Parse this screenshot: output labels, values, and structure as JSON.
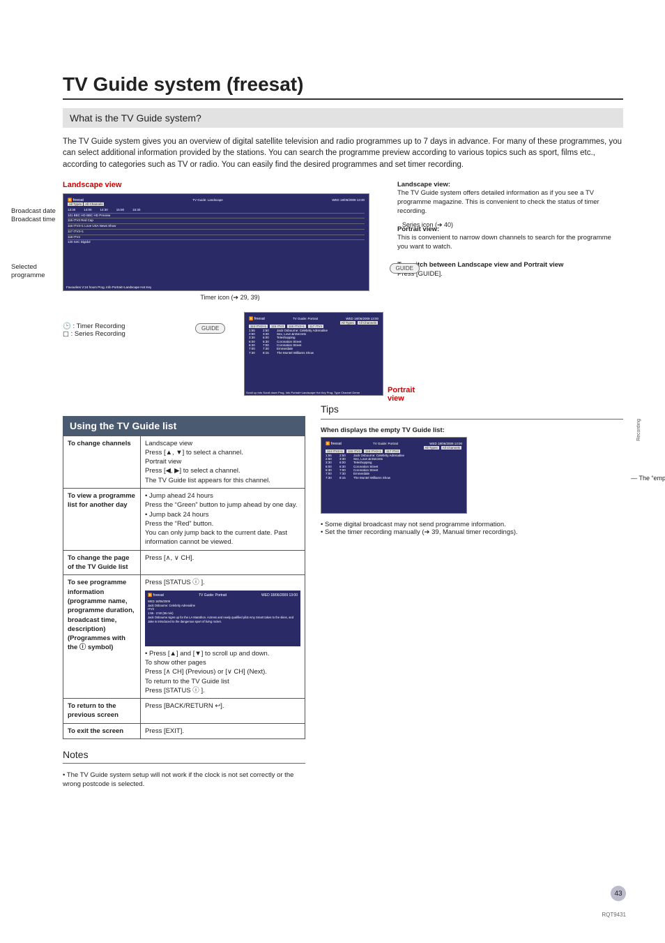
{
  "title": "TV Guide system (freesat)",
  "section1": {
    "heading": "What is the TV Guide system?",
    "body": "The TV Guide system gives you an overview of digital satellite television and radio programmes up to 7 days in advance. For many of these programmes, you can select additional information provided by the stations. You can search the programme preview according to various topics such as sport, films etc., according to categories such as TV or radio. You can easily find the desired programmes and set timer recording."
  },
  "landscape": {
    "label": "Landscape view",
    "broadcast_date": "Broadcast date",
    "broadcast_time": "Broadcast time",
    "selected_programme": "Selected programme",
    "timer_icon": "Timer icon (➔ 29, 39)",
    "series_icon": "Series icon (➔ 40)",
    "timer_rec_legend": ": Timer Recording",
    "series_rec_legend": ": Series Recording",
    "guide_btn": "GUIDE"
  },
  "fig_l": {
    "title": "TV Guide: Landscape",
    "date": "WED 18/06/2009 13:30",
    "tabs": [
      "All Types",
      "All Channels"
    ],
    "cols": [
      "13:30",
      "14:00",
      "14:30",
      "15:00",
      "15:30"
    ],
    "rows": [
      "101 BBC HD  BBC HD Preview",
      "115 ITV3  Red Cap",
      "116 ITV3+1  Love USA   News Show",
      "117 ITV3+1",
      "118 ITV4",
      "120 S4C Digidol"
    ],
    "footer": "Favourites   V:24 hours   Prog. Info   Portrait+Landscape   Hot Key"
  },
  "fig_p": {
    "title": "TV Guide: Portrait",
    "date": "WED 18/06/2009 13:00",
    "cols": [
      "114 ITV2+1",
      "115 ITV3",
      "116 ITV3+1",
      "117 ITV4"
    ],
    "tabs": [
      "All Types",
      "All Channels"
    ],
    "rows": [
      {
        "a": "1:55",
        "b": "2:50",
        "c": "Jack Osbourne: Celebrity Adrenaline"
      },
      {
        "a": "2:50",
        "b": "3:30",
        "c": "Sex, Love &nSecrets"
      },
      {
        "a": "3:30",
        "b": "6:00",
        "c": "Teleshopping"
      },
      {
        "a": "6:00",
        "b": "6:30",
        "c": "Coronation Street"
      },
      {
        "a": "6:30",
        "b": "7:00",
        "c": "Coronation Street"
      },
      {
        "a": "7:00",
        "b": "7:30",
        "c": "Emmerdale"
      },
      {
        "a": "7:30",
        "b": "8:15",
        "c": "The Montel Williams Show"
      }
    ],
    "footer": "Scroll up info   Scroll down   Prog. Info   Portrait+Landscape   Hot Key   Prog. Type   Channel Genre"
  },
  "portrait_label": "Portrait view",
  "right_desc": {
    "lv_h": "Landscape view:",
    "lv": "The TV Guide system offers detailed information as if you see a TV programme magazine. This is convenient to check the status of timer recording.",
    "pv_h": "Portrait view:",
    "pv": "This is convenient to narrow down channels to search for the programme you want to watch.",
    "sw_h": "To switch between Landscape view and Portrait view",
    "sw": "Press [GUIDE]."
  },
  "using_heading": "Using the TV Guide list",
  "table": [
    {
      "lab": "To change channels",
      "val": "Landscape view\nPress [▲, ▼] to select a channel.\nPortrait view\nPress [◀, ▶] to select a channel.\nThe TV Guide list appears for this channel."
    },
    {
      "lab": "To view a programme list for another day",
      "val": "• Jump ahead 24 hours\n  Press the “Green” button to jump ahead by one day.\n• Jump back 24 hours\n  Press the “Red” button.\n  You can only jump back to the current date. Past information cannot be viewed."
    },
    {
      "lab": "To change the page of the TV Guide list",
      "val": "Press [∧, ∨ CH]."
    },
    {
      "lab": "To see programme information\n(programme name, programme duration, broadcast time, description)\n(Programmes with the ⓘ symbol)",
      "val": "Press [STATUS ⓘ ].",
      "has_fig": true,
      "fig_title": "TV Guide: Portrait",
      "fig_date": "WED 18/06/2009 13:00",
      "fig_body": "WED 18/06/2009\nJack Osbourne: Celebrity Adrenaline\nITV3\n1:55 - 2:50 (55 min)\nJack Osbourne signs up for the LA Marathon. Actress and newly qualified pilot Amy Smart takes to the skies, and Jake is introduced to the dangerous sport of living rocket.",
      "suffix": "• Press [▲] and [▼] to scroll up and down.\nTo show other pages\nPress [∧ CH] (Previous) or [∨ CH] (Next).\nTo return to the TV Guide list\nPress [STATUS ⓘ ]."
    },
    {
      "lab": "To return to the previous screen",
      "val": "Press [BACK/RETURN ↩]."
    },
    {
      "lab": "To exit the screen",
      "val": "Press [EXIT]."
    }
  ],
  "notes_h": "Notes",
  "notes": "• The TV Guide system setup will not work if the clock is not set correctly or the wrong postcode is selected.",
  "tips_h": "Tips",
  "tips_sub": "When displays the empty TV Guide list:",
  "empty_field": "The “empty” field",
  "tips_bul": "• Some digital broadcast may not send programme information.\n• Set the timer recording manually (➔ 39, Manual timer recordings).",
  "side_tab": "Recording",
  "page_num": "43",
  "doc_id": "RQT9431"
}
